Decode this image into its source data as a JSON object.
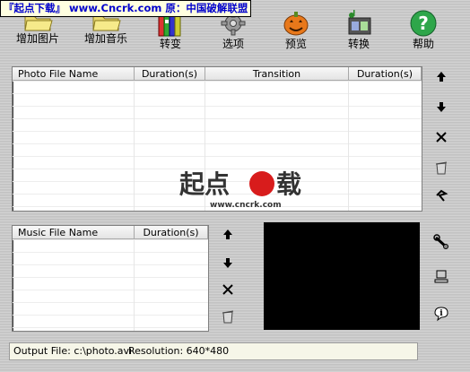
{
  "banner": {
    "text": "『起点下载』 www.Cncrk.com 原：中国破解联盟"
  },
  "toolbar": {
    "buttons": [
      {
        "label": "增加图片",
        "icon": "folder-icon"
      },
      {
        "label": "增加音乐",
        "icon": "folder-icon"
      },
      {
        "label": "转变",
        "icon": "books-icon"
      },
      {
        "label": "选项",
        "icon": "gear-icon"
      },
      {
        "label": "预览",
        "icon": "pumpkin-icon"
      },
      {
        "label": "转换",
        "icon": "film-music-icon"
      },
      {
        "label": "帮助",
        "icon": "help-icon"
      }
    ]
  },
  "photo_list": {
    "columns": [
      "Photo File Name",
      "Duration(s)",
      "Transition",
      "Duration(s)"
    ]
  },
  "music_list": {
    "columns": [
      "Music File Name",
      "Duration(s)"
    ]
  },
  "watermark": {
    "text": "起点",
    "text2": "载",
    "url": "www.cncrk.com"
  },
  "status": {
    "output_label": "Output File: c:\\photo.avi",
    "resolution_label": "Resolution: 640*480"
  },
  "colors": {
    "banner_text": "#0000cc",
    "banner_bg": "#ffffe0",
    "preview_bg": "#000000"
  }
}
